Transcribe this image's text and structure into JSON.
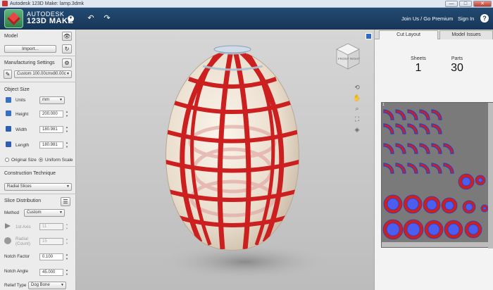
{
  "window": {
    "title": "Autodesk 123D Make: lamp.3dmk",
    "minimize": "—",
    "maximize": "□",
    "close": "✕"
  },
  "header": {
    "brand_line1": "AUTODESK",
    "brand_line2": "123D MAKE",
    "menu_arrow": "▼",
    "undo": "↶",
    "redo": "↷",
    "join": "Join Us / Go Premium",
    "sign_in": "Sign In",
    "help": "?"
  },
  "left": {
    "model": {
      "title": "Model",
      "import_label": "Import...",
      "visibility_icon": "eye-icon",
      "refresh_icon": "refresh-icon"
    },
    "manufacturing": {
      "title": "Manufacturing Settings",
      "preset": "Custom 100.00cmx80.00c",
      "gear_icon": "gear-icon"
    },
    "object_size": {
      "title": "Object Size",
      "units_label": "Units",
      "units_value": "mm",
      "height_label": "Height",
      "height_value": "200.000",
      "width_label": "Width",
      "width_value": "180.981",
      "length_label": "Length",
      "length_value": "180.981",
      "original_label": "Original Size",
      "uniform_label": "Uniform Scale",
      "uniform_selected": true
    },
    "construction": {
      "title": "Construction Technique",
      "value": "Radial Slices"
    },
    "slice": {
      "title": "Slice Distribution",
      "method_label": "Method",
      "method_value": "Custom",
      "axis1_label": "1st Axis",
      "axis1_value": "11",
      "radial_label": "Radial",
      "radial_label2": "(Count)",
      "radial_value": "15",
      "notch_factor_label": "Notch Factor",
      "notch_factor_value": "0.100",
      "notch_angle_label": "Notch Angle",
      "notch_angle_value": "45.000",
      "relief_label": "Relief Type",
      "relief_value": "Dog Bone"
    }
  },
  "viewcube": {
    "face_front": "FRONT",
    "face_right": "RIGHT"
  },
  "right": {
    "tabs": [
      "Cut Layout",
      "Model Issues"
    ],
    "active_tab": "Cut Layout",
    "sheets_label": "Sheets",
    "sheets_value": "1",
    "parts_label": "Parts",
    "parts_value": "30",
    "sheet_number": "1"
  },
  "colors": {
    "header": "#1e4066",
    "slice_red": "#cc1f1f",
    "part_blue": "#2a3fc7",
    "sheet_bg": "#7a7a7a"
  }
}
